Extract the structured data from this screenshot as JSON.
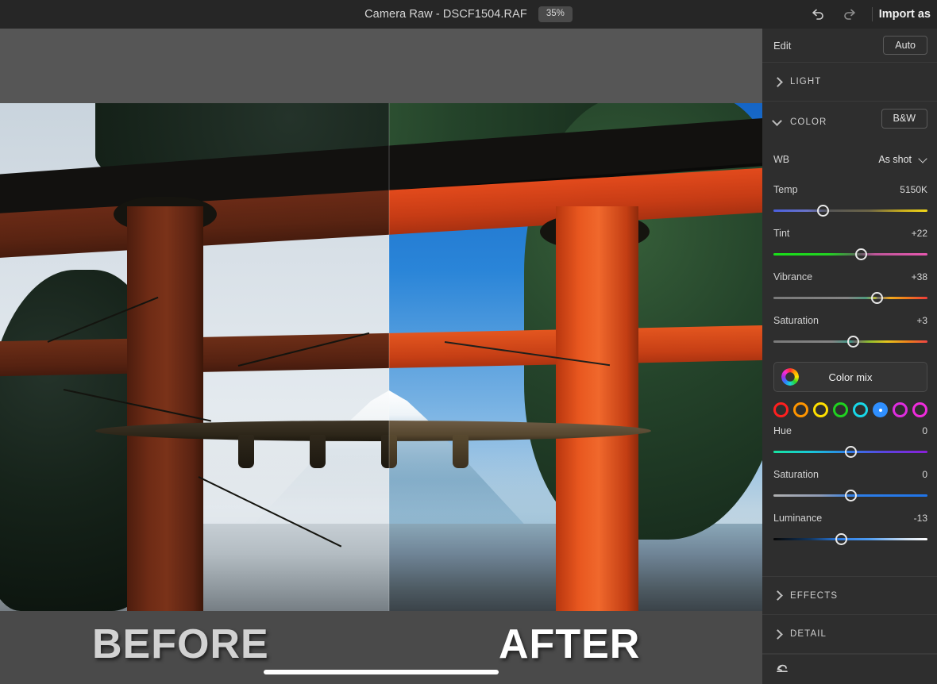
{
  "titlebar": {
    "title": "Camera Raw - DSCF1504.RAF",
    "zoom": "35%",
    "undo_icon": "undo-icon",
    "redo_icon": "redo-icon",
    "import_as": "Import as"
  },
  "photo": {
    "before_label": "BEFORE",
    "after_label": "AFTER"
  },
  "panel": {
    "edit_label": "Edit",
    "auto_label": "Auto",
    "sections": {
      "light": "LIGHT",
      "color": "COLOR",
      "effects": "EFFECTS",
      "detail": "DETAIL"
    },
    "bw_label": "B&W",
    "wb": {
      "label": "WB",
      "value": "As shot"
    },
    "sliders": [
      {
        "name": "Temp",
        "value": "5150K",
        "pos": 32
      },
      {
        "name": "Tint",
        "value": "+22",
        "pos": 57
      },
      {
        "name": "Vibrance",
        "value": "+38",
        "pos": 67.5
      },
      {
        "name": "Saturation",
        "value": "+3",
        "pos": 52
      }
    ],
    "color_mix": {
      "label": "Color mix",
      "icon": "color-wheel-icon",
      "swatches": [
        {
          "name": "red",
          "color": "#ff1f1f",
          "selected": false
        },
        {
          "name": "orange",
          "color": "#ff9500",
          "selected": false
        },
        {
          "name": "yellow",
          "color": "#ffe000",
          "selected": false
        },
        {
          "name": "green",
          "color": "#1fd41f",
          "selected": false
        },
        {
          "name": "aqua",
          "color": "#18d8e8",
          "selected": false
        },
        {
          "name": "blue",
          "color": "#2f8fff",
          "selected": true
        },
        {
          "name": "purple",
          "color": "#e02be0",
          "selected": false
        },
        {
          "name": "magenta",
          "color": "#f02bdc",
          "selected": false
        }
      ]
    },
    "channel_sliders": [
      {
        "name": "Hue",
        "value": "0",
        "pos": 50
      },
      {
        "name": "Saturation",
        "value": "0",
        "pos": 50
      },
      {
        "name": "Luminance",
        "value": "-13",
        "pos": 44
      }
    ],
    "reset_icon": "reset-icon"
  },
  "colors": {
    "panel_bg": "#2e2e2e",
    "titlebar_bg": "#262626",
    "accent_blue": "#2f8fff"
  }
}
